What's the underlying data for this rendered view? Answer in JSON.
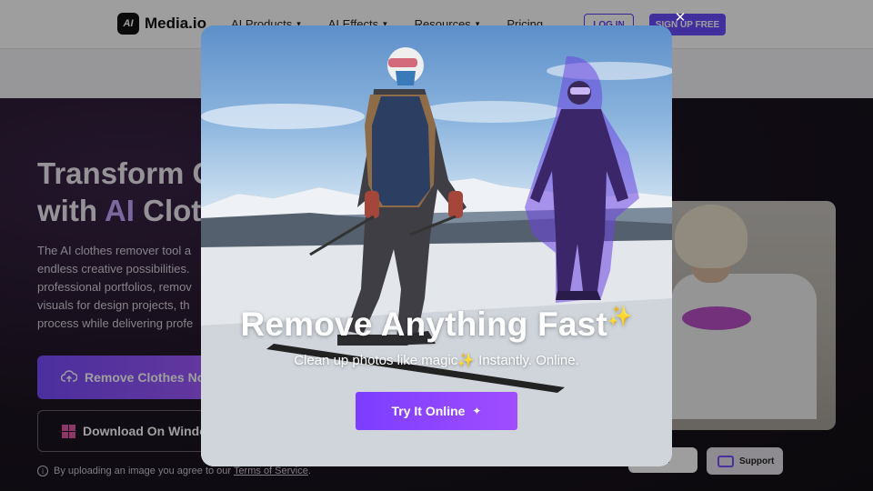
{
  "header": {
    "logo_mark": "AI",
    "brand": "Media.io",
    "nav": [
      {
        "label": "AI Products"
      },
      {
        "label": "AI Effects"
      },
      {
        "label": "Resources"
      },
      {
        "label": "Pricing"
      }
    ],
    "login_label": "LOG IN",
    "signup_label": "SIGN UP FREE"
  },
  "hero": {
    "title_line1": "Transform C",
    "title_line2_prefix": "with ",
    "title_line2_ai": "AI",
    "title_line2_suffix": " Clot",
    "description_lines": [
      "The AI clothes remover tool a",
      "endless creative possibilities.",
      "professional portfolios, remov",
      "visuals for design projects, th",
      "process while delivering profe"
    ],
    "primary_button": "Remove Clothes Now",
    "secondary_button": "Download On Windo",
    "note_prefix": "By uploading an image you agree to our ",
    "note_link": "Terms of Service",
    "note_suffix": "."
  },
  "floating": {
    "left_chip": "!",
    "support_label": "Support"
  },
  "modal": {
    "close_glyph": "✕",
    "title": "Remove Anything Fast",
    "title_spark": "✨",
    "subtitle_before": "Clean up photos like magic",
    "subtitle_star": "✨",
    "subtitle_after": " Instantly. Online.",
    "cta_label": "Try It Online",
    "cta_glyph": "✦"
  },
  "colors": {
    "accent": "#6b4dff",
    "cta": "#8a44ff",
    "highlight_figure": "#5a2fd6"
  }
}
